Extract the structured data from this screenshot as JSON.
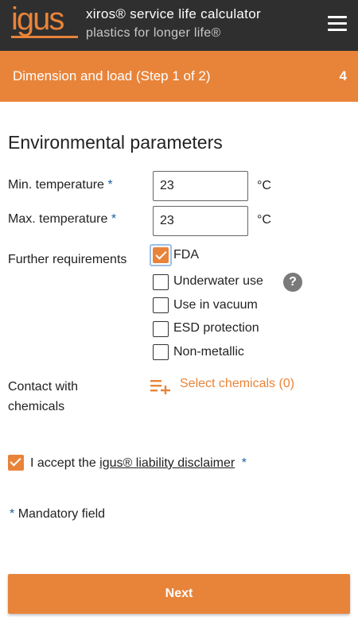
{
  "header": {
    "logo": "igus",
    "title": "xiros® service life calculator",
    "subtitle": "plastics for longer life®",
    "menu_icon": "hamburger-menu-icon"
  },
  "step": {
    "title": "Dimension and load (Step 1 of 2)",
    "count": "4"
  },
  "section_title": "Environmental parameters",
  "fields": {
    "min_temp": {
      "label": "Min. temperature",
      "required": "*",
      "value": "23",
      "unit": "°C"
    },
    "max_temp": {
      "label": "Max. temperature",
      "required": "*",
      "value": "23",
      "unit": "°C"
    }
  },
  "further_requirements": {
    "label": "Further requirements",
    "options": [
      {
        "label": "FDA",
        "checked": true
      },
      {
        "label": "Underwater use",
        "checked": false
      },
      {
        "label": "Use in vacuum",
        "checked": false
      },
      {
        "label": "ESD protection",
        "checked": false
      },
      {
        "label": "Non-metallic",
        "checked": false
      }
    ],
    "help_icon": "?"
  },
  "chemicals": {
    "label_line1": "Contact with",
    "label_line2": "chemicals",
    "link": "Select chemicals (0)",
    "icon": "playlist-add-icon"
  },
  "disclaimer": {
    "prefix": "I accept the ",
    "link": "igus® liability disclaimer",
    "required": "*",
    "checked": true
  },
  "mandatory": {
    "star": "*",
    "text": "Mandatory field"
  },
  "next_button": "Next",
  "colors": {
    "accent": "#e8843a",
    "appbar": "#2f2f2f",
    "required_star": "#1a5fa0"
  }
}
